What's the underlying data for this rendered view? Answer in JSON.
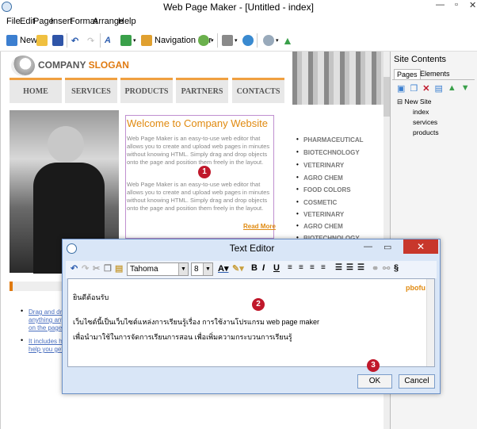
{
  "window": {
    "title": "Web Page Maker - [Untitled - index]"
  },
  "menu": [
    "File",
    "Edit",
    "Page",
    "Insert",
    "Format",
    "Arrange",
    "Help"
  ],
  "toolbar": {
    "new_label": "New",
    "navbar_label": "Navigation Bar"
  },
  "site": {
    "logo_company": "COMPANY",
    "logo_slogan": "SLOGAN",
    "nav": [
      "HOME",
      "SERVICES",
      "PRODUCTS",
      "PARTNERS",
      "CONTACTS"
    ],
    "welcome_title": "Welcome to Company Website",
    "welcome_p1": "Web Page Maker is an easy-to-use web editor that allows you to create and upload web pages in minutes without knowing HTML. Simply drag and drop objects onto the page and position them freely in the layout.",
    "welcome_p2": "Web Page Maker is an easy-to-use web editor that allows you to create and upload web pages in minutes without knowing HTML. Simply drag and drop objects onto the page and position them freely in the layout.",
    "read_more": "Read More",
    "categories": [
      "PHARMACEUTICAL",
      "BIOTECHNOLOGY",
      "VETERINARY",
      "AGRO CHEM",
      "FOOD COLORS",
      "COSMETIC",
      "VETERINARY",
      "AGRO CHEM",
      "BIOTECHNOLOGY"
    ],
    "bullets": [
      [
        "Drag and drop",
        "anything anyw",
        "on the page."
      ],
      [
        "It includes hig",
        "help you get s"
      ]
    ]
  },
  "panel": {
    "title": "Site Contents",
    "tabs": [
      "Pages",
      "Elements"
    ],
    "tree_root": "New Site",
    "tree_items": [
      "index",
      "services",
      "products"
    ]
  },
  "dialog": {
    "title": "Text Editor",
    "font": "Tahoma",
    "size": "8",
    "text_corner": "pbofu",
    "lines": [
      "ยินดีต้อนรับ",
      "เว็บไซต์นี้เป็นเว็บไซต์แหล่งการเรียนรู้เรื่อง  การใช้งานโปรแกรม  web page maker",
      "เพื่อนำมาใช้ในการจัดการเรียนการสอน  เพื่อเพิ่มความกระบวนการเรียนรู้"
    ],
    "ok_label": "OK",
    "cancel_label": "Cancel"
  },
  "callouts": [
    "1",
    "2",
    "3"
  ],
  "colors": {
    "accent": "#e07a10",
    "badge": "#c0182b",
    "dialog_bg": "#d9e6f7",
    "close_red": "#c8372b"
  }
}
